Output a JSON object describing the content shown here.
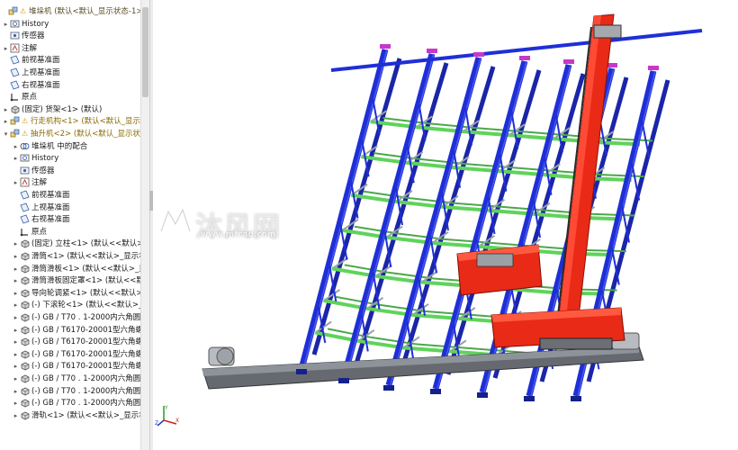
{
  "feature_tree": {
    "items": [
      {
        "label": "堆垛机  (默认<默认_显示状态-1>)",
        "icon": "assembly-icon",
        "warn": true,
        "expander": "",
        "indent": 0,
        "color": "#5a4b2a"
      },
      {
        "label": "History",
        "icon": "history-icon",
        "expander": "▸",
        "indent": 1
      },
      {
        "label": "传感器",
        "icon": "sensor-icon",
        "expander": "",
        "indent": 1
      },
      {
        "label": "注解",
        "icon": "annotation-icon",
        "expander": "▸",
        "indent": 1
      },
      {
        "label": "前视基准面",
        "icon": "plane-icon",
        "expander": "",
        "indent": 1
      },
      {
        "label": "上视基准面",
        "icon": "plane-icon",
        "expander": "",
        "indent": 1
      },
      {
        "label": "右视基准面",
        "icon": "plane-icon",
        "expander": "",
        "indent": 1
      },
      {
        "label": "原点",
        "icon": "origin-icon",
        "expander": "",
        "indent": 1
      },
      {
        "label": "(固定) 货架<1> (默认)",
        "icon": "part-icon",
        "expander": "▸",
        "indent": 1
      },
      {
        "label": "行走机构<1> (默认<默认_显示状态",
        "icon": "subassembly-icon",
        "warn": true,
        "expander": "▸",
        "indent": 1,
        "color": "#8a6a00"
      },
      {
        "label": "抽升机<2> (默认<默认_显示状态-",
        "icon": "subassembly-icon",
        "warn": true,
        "expander": "▾",
        "indent": 1,
        "color": "#8a6a00"
      },
      {
        "label": "堆垛机 中的配合",
        "icon": "mates-icon",
        "expander": "▸",
        "indent": 2
      },
      {
        "label": "History",
        "icon": "history-icon",
        "expander": "▸",
        "indent": 2
      },
      {
        "label": "传感器",
        "icon": "sensor-icon",
        "expander": "",
        "indent": 2
      },
      {
        "label": "注解",
        "icon": "annotation-icon",
        "expander": "▸",
        "indent": 2
      },
      {
        "label": "前视基准面",
        "icon": "plane-icon",
        "expander": "",
        "indent": 2
      },
      {
        "label": "上视基准面",
        "icon": "plane-icon",
        "expander": "",
        "indent": 2
      },
      {
        "label": "右视基准面",
        "icon": "plane-icon",
        "expander": "",
        "indent": 2
      },
      {
        "label": "原点",
        "icon": "origin-icon",
        "expander": "",
        "indent": 2
      },
      {
        "label": "(固定) 立柱<1> (默认<<默认>_显",
        "icon": "part-icon",
        "expander": "▸",
        "indent": 2
      },
      {
        "label": "滑筒<1> (默认<<默认>_显示状态",
        "icon": "part-icon",
        "expander": "▸",
        "indent": 2
      },
      {
        "label": "滑筒滑板<1> (默认<<默认>_显示",
        "icon": "part-icon",
        "expander": "▸",
        "indent": 2
      },
      {
        "label": "滑筒滑板固定罩<1> (默认<<默认",
        "icon": "part-icon",
        "expander": "▸",
        "indent": 2
      },
      {
        "label": "导向轮调紧<1> (默认<<默认>_显",
        "icon": "part-icon",
        "expander": "▸",
        "indent": 2
      },
      {
        "label": "(-) 下滚轮<1> (默认<<默认>_显示",
        "icon": "part-icon",
        "expander": "▸",
        "indent": 2
      },
      {
        "label": "(-) GB / T70 . 1-2000内六角圆柱头",
        "icon": "part-icon",
        "expander": "▸",
        "indent": 2
      },
      {
        "label": "(-) GB / T6170-20001型六角螺母",
        "icon": "part-icon",
        "expander": "▸",
        "indent": 2
      },
      {
        "label": "(-) GB / T6170-20001型六角螺母",
        "icon": "part-icon",
        "expander": "▸",
        "indent": 2
      },
      {
        "label": "(-) GB / T6170-20001型六角螺母",
        "icon": "part-icon",
        "expander": "▸",
        "indent": 2
      },
      {
        "label": "(-) GB / T6170-20001型六角螺母",
        "icon": "part-icon",
        "expander": "▸",
        "indent": 2
      },
      {
        "label": "(-) GB / T70 . 1-2000内六角圆柱头",
        "icon": "part-icon",
        "expander": "▸",
        "indent": 2
      },
      {
        "label": "(-) GB / T70 . 1-2000内六角圆柱头",
        "icon": "part-icon",
        "expander": "▸",
        "indent": 2
      },
      {
        "label": "(-) GB / T70 . 1-2000内六角圆柱头",
        "icon": "part-icon",
        "expander": "▸",
        "indent": 2
      },
      {
        "label": "滑轨<1> (默认<<默认>_显示状态-",
        "icon": "part-icon",
        "expander": "▸",
        "indent": 2
      }
    ]
  },
  "watermark": {
    "text": "沐风网",
    "url": "www.mfcad.com"
  },
  "triad": {
    "x_label": "X",
    "y_label": "Y",
    "z_label": "Z"
  },
  "colors": {
    "rack_blue": "#1f2fd6",
    "beam_green": "#5fd35a",
    "column_red": "#e82a17",
    "rail_gray": "#666a70",
    "cap_magenta": "#c838c8"
  }
}
